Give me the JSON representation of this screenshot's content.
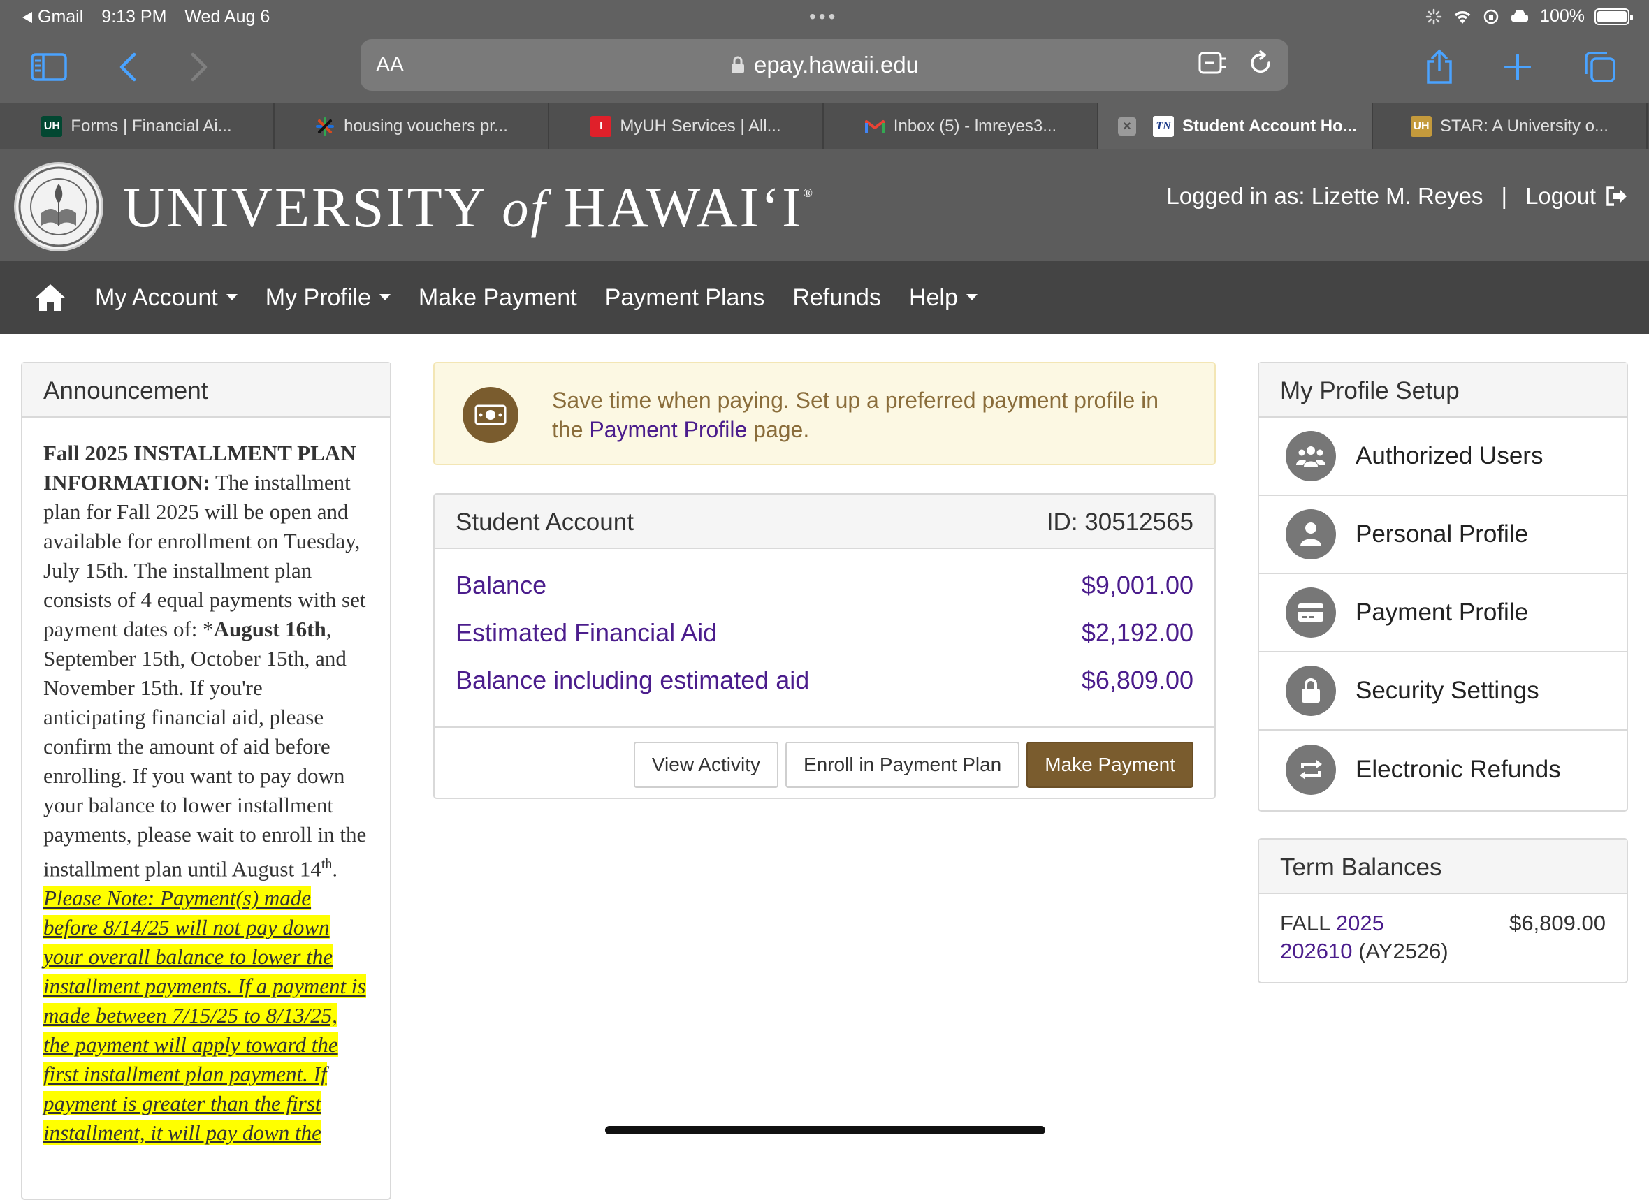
{
  "status": {
    "back_app": "Gmail",
    "time": "9:13 PM",
    "date": "Wed Aug 6",
    "battery": "100%"
  },
  "browser": {
    "aa_label": "AA",
    "url": "epay.hawaii.edu"
  },
  "tabs": [
    {
      "label": "Forms | Financial Ai...",
      "fav": "UH"
    },
    {
      "label": "housing vouchers pr...",
      "fav": "*"
    },
    {
      "label": "MyUH Services | All...",
      "fav": "I"
    },
    {
      "label": "Inbox (5) - lmreyes3...",
      "fav": "M"
    },
    {
      "label": "Student Account Ho...",
      "fav": "TN"
    },
    {
      "label": "STAR: A University o...",
      "fav": "UH"
    }
  ],
  "header": {
    "wordmark_pre": "UNIVERSITY",
    "wordmark_of": "of",
    "wordmark_post": "HAWAIʻI",
    "registered": "®",
    "logged_in": "Logged in as: Lizette M. Reyes",
    "separator": "|",
    "logout": "Logout"
  },
  "nav": {
    "my_account": "My Account",
    "my_profile": "My Profile",
    "make_payment": "Make Payment",
    "payment_plans": "Payment Plans",
    "refunds": "Refunds",
    "help": "Help"
  },
  "announcement": {
    "title": "Announcement",
    "heading": "Fall 2025 INSTALLMENT PLAN INFORMATION:",
    "p1": " The installment plan for Fall 2025 will be open and available for enrollment on Tuesday, July 15th. The installment plan consists of 4 equal payments with set payment dates of: *",
    "p1_bold": "August 16th",
    "p2": ", September 15th, October 15th, and November 15th. If you're anticipating financial aid, please confirm the amount of aid before enrolling. If you want to pay down your balance to lower installment payments, please wait to enroll in the installment plan until August 14",
    "p2_sup": "th",
    "p2_end": ".",
    "note": "Please Note: Payment(s) made before 8/14/25 will not pay down your overall balance to lower the installment payments. If a payment is made between 7/15/25 to 8/13/25, the payment will apply toward the first installment plan payment. If payment is greater than the first installment, it will pay down the"
  },
  "promo": {
    "text_pre": "Save time when paying. Set up a preferred payment profile in the ",
    "link": "Payment Profile",
    "text_post": " page."
  },
  "student_account": {
    "title": "Student Account",
    "id": "ID: 30512565",
    "rows": [
      {
        "label": "Balance",
        "value": "$9,001.00"
      },
      {
        "label": "Estimated Financial Aid",
        "value": "$2,192.00"
      },
      {
        "label": "Balance including estimated aid",
        "value": "$6,809.00"
      }
    ],
    "btn_view_activity": "View Activity",
    "btn_enroll": "Enroll in Payment Plan",
    "btn_make_payment": "Make Payment"
  },
  "profile_setup": {
    "title": "My Profile Setup",
    "items": [
      {
        "label": "Authorized Users",
        "icon": "users-icon"
      },
      {
        "label": "Personal Profile",
        "icon": "user-icon"
      },
      {
        "label": "Payment Profile",
        "icon": "credit-card-icon"
      },
      {
        "label": "Security Settings",
        "icon": "lock-icon"
      },
      {
        "label": "Electronic Refunds",
        "icon": "exchange-icon"
      }
    ]
  },
  "term_balances": {
    "title": "Term Balances",
    "term_word": "FALL",
    "term_year": "2025",
    "term_code": "202610",
    "term_ay": "(AY2526)",
    "amount": "$6,809.00"
  },
  "colors": {
    "header_bg": "#5c5c5c",
    "nav_bg": "#444444",
    "link_purple": "#4b1d8c",
    "brand_gold": "#7a5c2e",
    "highlight": "#ffff00"
  }
}
